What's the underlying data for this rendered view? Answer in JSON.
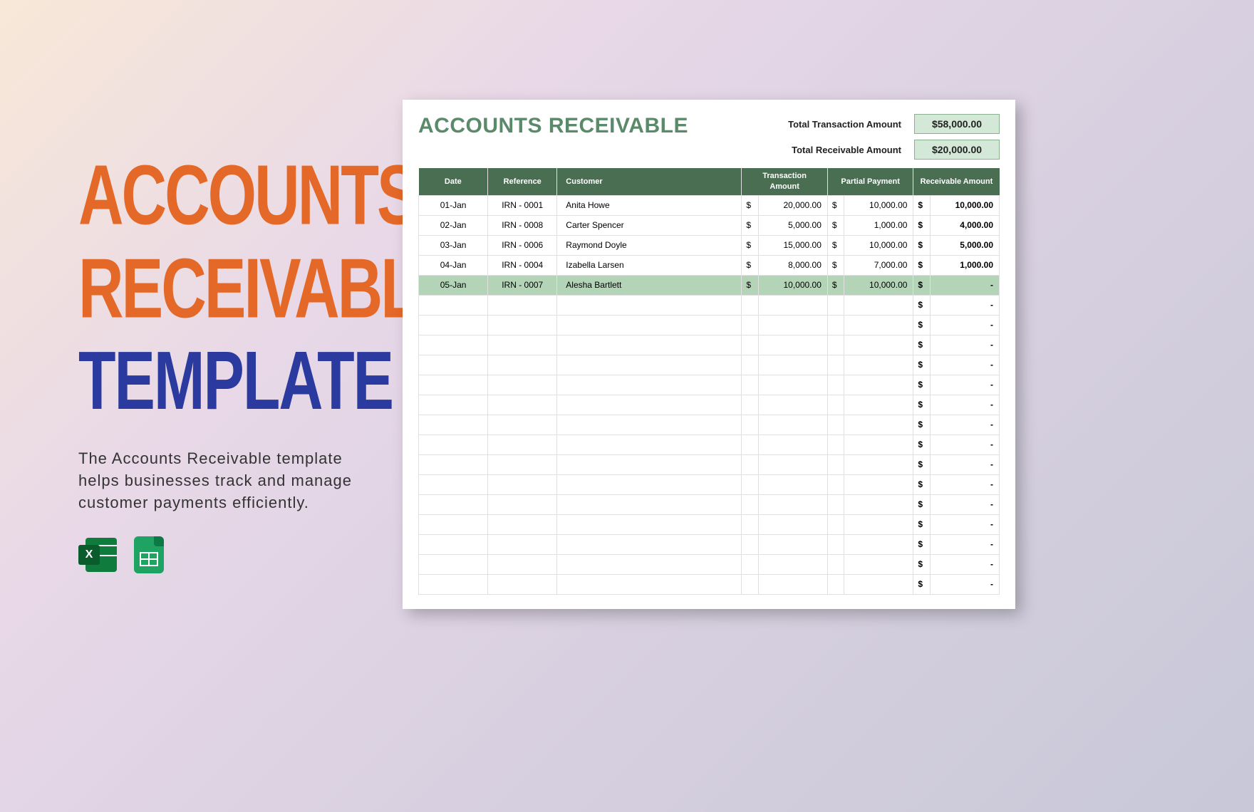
{
  "promo": {
    "title_line1": "ACCOUNTS",
    "title_line2": "RECEIVABLE",
    "title_line3": "TEMPLATE",
    "description": "The Accounts Receivable template helps businesses track and manage customer payments efficiently."
  },
  "sheet": {
    "title": "ACCOUNTS RECEIVABLE",
    "totals": {
      "transaction_label": "Total Transaction Amount",
      "transaction_value": "$58,000.00",
      "receivable_label": "Total Receivable Amount",
      "receivable_value": "$20,000.00"
    },
    "headers": {
      "date": "Date",
      "reference": "Reference",
      "customer": "Customer",
      "transaction": "Transaction Amount",
      "partial": "Partial Payment",
      "receivable": "Receivable Amount"
    },
    "rows": [
      {
        "date": "01-Jan",
        "ref": "IRN - 0001",
        "customer": "Anita Howe",
        "txn": "20,000.00",
        "partial": "10,000.00",
        "recv": "10,000.00",
        "highlighted": false
      },
      {
        "date": "02-Jan",
        "ref": "IRN - 0008",
        "customer": "Carter Spencer",
        "txn": "5,000.00",
        "partial": "1,000.00",
        "recv": "4,000.00",
        "highlighted": false
      },
      {
        "date": "03-Jan",
        "ref": "IRN - 0006",
        "customer": "Raymond Doyle",
        "txn": "15,000.00",
        "partial": "10,000.00",
        "recv": "5,000.00",
        "highlighted": false
      },
      {
        "date": "04-Jan",
        "ref": "IRN - 0004",
        "customer": "Izabella Larsen",
        "txn": "8,000.00",
        "partial": "7,000.00",
        "recv": "1,000.00",
        "highlighted": false
      },
      {
        "date": "05-Jan",
        "ref": "IRN - 0007",
        "customer": "Alesha Bartlett",
        "txn": "10,000.00",
        "partial": "10,000.00",
        "recv": "-",
        "highlighted": true
      }
    ],
    "empty_rows": 15,
    "currency": "$",
    "dash": "-"
  },
  "icons": {
    "excel_letter": "X"
  }
}
